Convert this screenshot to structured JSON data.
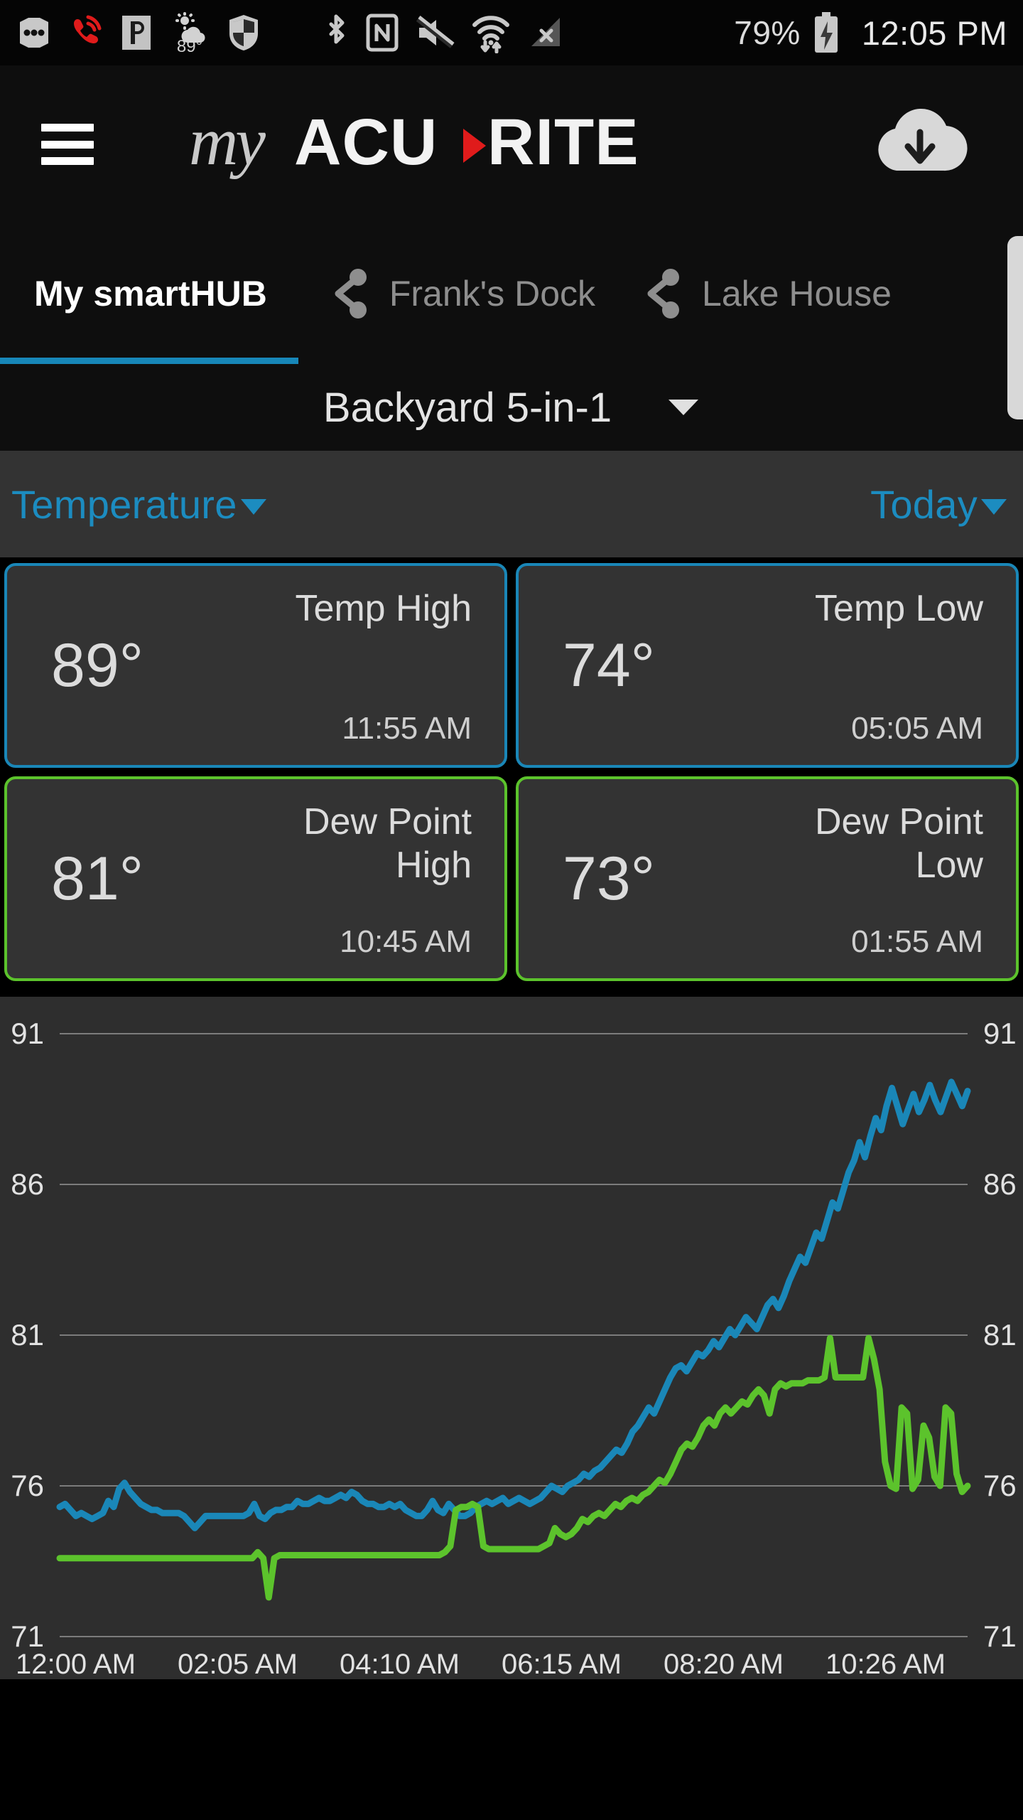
{
  "status_bar": {
    "icons": [
      "more-dots-icon",
      "missed-call-icon",
      "pandora-icon",
      "weather-89-icon",
      "shield-icon",
      "bluetooth-icon",
      "nfc-icon",
      "mute-icon",
      "wifi-transfer-icon",
      "no-signal-icon"
    ],
    "weather_temp": "89",
    "battery_percent": "79%",
    "battery_state": "charging",
    "clock": "12:05 PM"
  },
  "app_bar": {
    "menu_icon": "hamburger-menu-icon",
    "logo_my": "my",
    "logo_acu": "ACU",
    "logo_rite": "RITE",
    "download_icon": "cloud-download-icon"
  },
  "tabs": [
    {
      "label": "My smartHUB",
      "active": true,
      "icon": null
    },
    {
      "label": "Frank's Dock",
      "active": false,
      "icon": "share-icon"
    },
    {
      "label": "Lake House",
      "active": false,
      "icon": "share-icon"
    }
  ],
  "device_selector": {
    "name": "Backyard 5-in-1",
    "caret": "chevron-down-icon"
  },
  "filters": {
    "metric": "Temperature",
    "metric_caret": "caret-down-icon",
    "range": "Today",
    "range_caret": "caret-down-icon"
  },
  "cards": [
    {
      "value": "89°",
      "label": "Temp High",
      "time": "11:55 AM",
      "accent": "#1a87b8",
      "type": "temp"
    },
    {
      "value": "74°",
      "label": "Temp Low",
      "time": "05:05 AM",
      "accent": "#1a87b8",
      "type": "temp"
    },
    {
      "value": "81°",
      "label": "Dew Point High",
      "time": "10:45 AM",
      "accent": "#5cc32c",
      "type": "dew"
    },
    {
      "value": "73°",
      "label": "Dew Point Low",
      "time": "01:55 AM",
      "accent": "#5cc32c",
      "type": "dew"
    }
  ],
  "colors": {
    "accent_blue": "#1a87b8",
    "accent_green": "#5cc32c",
    "tab_underline": "#1787b8",
    "filter_link": "#1c8cc0",
    "chart_bg": "#2e2e2e",
    "grid": "#8a8a8a"
  },
  "chart_data": {
    "type": "line",
    "title": "",
    "xlabel": "",
    "ylabel": "",
    "ylim": [
      71,
      91
    ],
    "yticks": [
      71,
      76,
      81,
      86,
      91
    ],
    "ytick_labels_left": [
      "91",
      "86",
      "81",
      "76",
      "71"
    ],
    "ytick_labels_right": [
      "91",
      "86",
      "81",
      "76",
      "71"
    ],
    "xticks": [
      "12:00 AM",
      "02:05 AM",
      "04:10 AM",
      "06:15 AM",
      "08:20 AM",
      "10:26 AM"
    ],
    "grid": true,
    "legend": "none",
    "series": [
      {
        "name": "Temperature",
        "color": "#1a87b8",
        "values": [
          75.3,
          75.4,
          75.2,
          75.0,
          75.1,
          75.0,
          74.9,
          75.0,
          75.1,
          75.5,
          75.3,
          75.9,
          76.1,
          75.8,
          75.6,
          75.4,
          75.3,
          75.2,
          75.2,
          75.1,
          75.1,
          75.1,
          75.1,
          75.0,
          74.8,
          74.6,
          74.8,
          75.0,
          75.0,
          75.0,
          75.0,
          75.0,
          75.0,
          75.0,
          75.0,
          75.1,
          75.4,
          75.0,
          74.9,
          75.1,
          75.2,
          75.2,
          75.3,
          75.3,
          75.5,
          75.4,
          75.4,
          75.5,
          75.6,
          75.5,
          75.5,
          75.6,
          75.7,
          75.6,
          75.8,
          75.7,
          75.5,
          75.4,
          75.4,
          75.3,
          75.3,
          75.4,
          75.3,
          75.4,
          75.2,
          75.1,
          75.0,
          75.0,
          75.2,
          75.5,
          75.2,
          75.1,
          75.4,
          75.2,
          75.0,
          75.0,
          75.1,
          75.3,
          75.4,
          75.5,
          75.4,
          75.5,
          75.6,
          75.4,
          75.5,
          75.6,
          75.5,
          75.4,
          75.5,
          75.6,
          75.8,
          76.0,
          75.9,
          75.8,
          76.0,
          76.1,
          76.2,
          76.4,
          76.3,
          76.5,
          76.6,
          76.8,
          77.0,
          77.2,
          77.1,
          77.4,
          77.8,
          78.0,
          78.3,
          78.6,
          78.4,
          78.8,
          79.2,
          79.6,
          79.9,
          80.0,
          79.8,
          80.1,
          80.4,
          80.3,
          80.5,
          80.8,
          80.6,
          80.9,
          81.2,
          81.0,
          81.3,
          81.6,
          81.4,
          81.2,
          81.6,
          82.0,
          82.2,
          81.9,
          82.3,
          82.8,
          83.2,
          83.6,
          83.4,
          83.9,
          84.4,
          84.2,
          84.8,
          85.4,
          85.2,
          85.8,
          86.4,
          86.8,
          87.4,
          86.9,
          87.6,
          88.2,
          87.8,
          88.6,
          89.2,
          88.6,
          88.0,
          88.5,
          89.0,
          88.4,
          88.8,
          89.3,
          88.8,
          88.4,
          88.9,
          89.4,
          89.0,
          88.6,
          89.1
        ]
      },
      {
        "name": "Dew Point",
        "color": "#5cc32c",
        "values": [
          73.6,
          73.6,
          73.6,
          73.6,
          73.6,
          73.6,
          73.6,
          73.6,
          73.6,
          73.6,
          73.6,
          73.6,
          73.6,
          73.6,
          73.6,
          73.6,
          73.6,
          73.6,
          73.6,
          73.6,
          73.6,
          73.6,
          73.6,
          73.6,
          73.6,
          73.6,
          73.6,
          73.6,
          73.6,
          73.6,
          73.6,
          73.6,
          73.6,
          73.6,
          73.6,
          73.6,
          73.8,
          73.6,
          72.3,
          73.6,
          73.7,
          73.7,
          73.7,
          73.7,
          73.7,
          73.7,
          73.7,
          73.7,
          73.7,
          73.7,
          73.7,
          73.7,
          73.7,
          73.7,
          73.7,
          73.7,
          73.7,
          73.7,
          73.7,
          73.7,
          73.7,
          73.7,
          73.7,
          73.7,
          73.7,
          73.7,
          73.7,
          73.7,
          73.7,
          73.7,
          73.8,
          74.0,
          75.2,
          75.3,
          75.3,
          75.4,
          75.3,
          74.0,
          73.9,
          73.9,
          73.9,
          73.9,
          73.9,
          73.9,
          73.9,
          73.9,
          73.9,
          73.9,
          74.0,
          74.1,
          74.6,
          74.4,
          74.3,
          74.4,
          74.6,
          74.9,
          74.8,
          75.0,
          75.1,
          75.0,
          75.2,
          75.4,
          75.3,
          75.5,
          75.6,
          75.5,
          75.7,
          75.8,
          76.0,
          76.2,
          76.1,
          76.4,
          76.8,
          77.2,
          77.4,
          77.3,
          77.6,
          78.0,
          78.2,
          78.0,
          78.4,
          78.6,
          78.4,
          78.6,
          78.8,
          78.7,
          79.0,
          79.2,
          79.0,
          78.4,
          79.2,
          79.4,
          79.3,
          79.4,
          79.4,
          79.4,
          79.5,
          79.5,
          79.5,
          79.6,
          80.9,
          79.6,
          79.6,
          79.6,
          79.6,
          79.6,
          79.6,
          80.9,
          80.2,
          79.2,
          76.8,
          76.0,
          75.9,
          78.6,
          78.4,
          75.9,
          76.2,
          78.0,
          77.6,
          76.3,
          76.0,
          78.6,
          78.4,
          76.4,
          75.8,
          76.0
        ]
      }
    ]
  }
}
